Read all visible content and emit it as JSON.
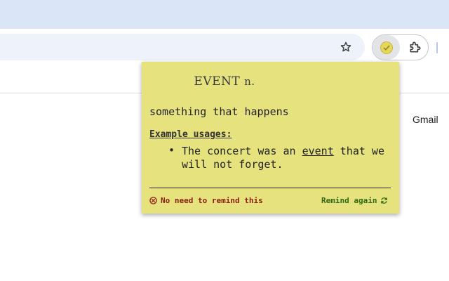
{
  "browser": {
    "icons": {
      "star": "star-icon",
      "extension_active": "check-icon",
      "extensions": "puzzle-icon"
    }
  },
  "page": {
    "gmail_link": "Gmail"
  },
  "popup": {
    "word": "EVENT",
    "part_of_speech": "n.",
    "definition": "something that happens",
    "usages_heading": "Example usages:",
    "usage": {
      "before": "The concert was an ",
      "word": "event",
      "after": " that we will not forget."
    },
    "no_remind_label": "No need to remind this",
    "remind_again_label": "Remind again",
    "colors": {
      "background": "#e6e27e",
      "no_remind": "#8b1d12",
      "remind_again": "#2f6b12"
    }
  }
}
